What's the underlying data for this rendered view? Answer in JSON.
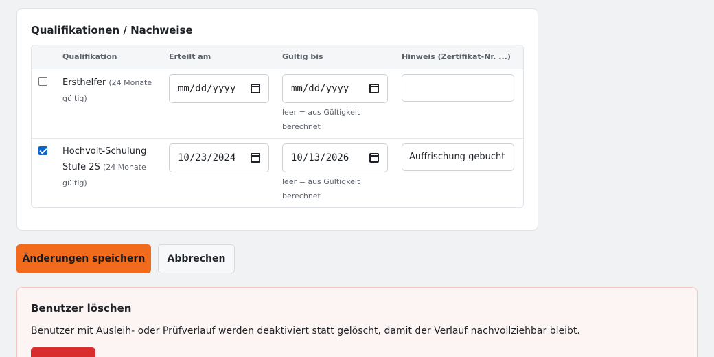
{
  "qualifications": {
    "title": "Qualifikationen / Nachweise",
    "columns": [
      "Qualifikation",
      "Erteilt am",
      "Gültig bis",
      "Hinweis (Zertifikat-Nr. ...)"
    ],
    "rows": [
      {
        "checked": false,
        "name": "Ersthelfer",
        "validity_note": "(24 Monate gültig)",
        "issued": "mm/dd/yyyy",
        "valid_until": "mm/dd/yyyy",
        "valid_hint": "leer = aus Gültigkeit berechnet",
        "note_value": ""
      },
      {
        "checked": true,
        "name": "Hochvolt-Schulung Stufe 2S",
        "validity_note": "(24 Monate gültig)",
        "issued": "10/23/2024",
        "valid_until": "10/13/2026",
        "valid_hint": "leer = aus Gültigkeit berechnet",
        "note_value": "Auffrischung gebucht"
      }
    ]
  },
  "actions": {
    "save_label": "Änderungen speichern",
    "cancel_label": "Abbrechen"
  },
  "delete_section": {
    "title": "Benutzer löschen",
    "text": "Benutzer mit Ausleih- oder Prüfverlauf werden deaktiviert statt gelöscht, damit der Verlauf nachvollziehbar bleibt."
  },
  "colors": {
    "accent": "#f26a1b",
    "danger": "#d92d2d",
    "checkbox": "#0b63ce"
  }
}
